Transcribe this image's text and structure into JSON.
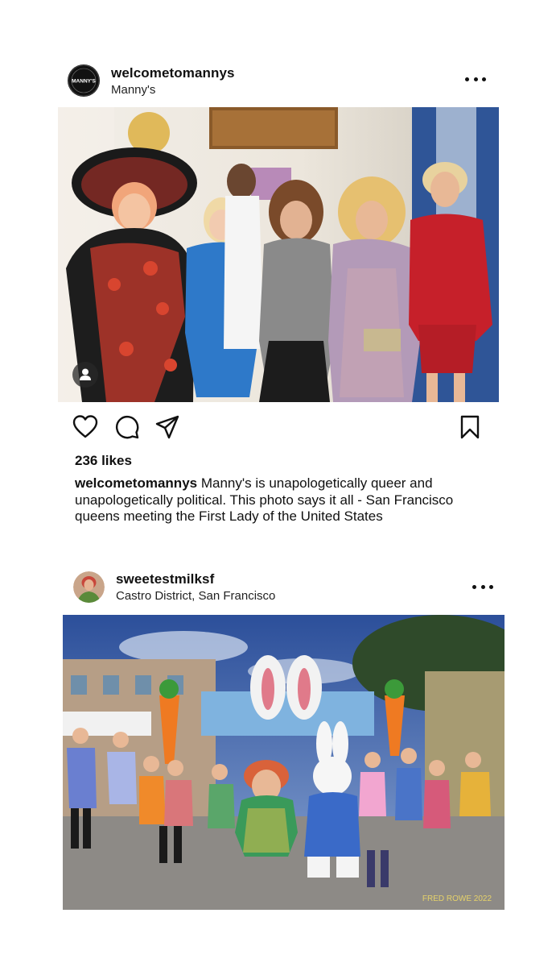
{
  "posts": [
    {
      "username": "welcometomannys",
      "location": "Manny's",
      "avatar_text": "MANNY'S",
      "likes": "236 likes",
      "caption_user": "welcometomannys",
      "caption_text": "Manny's is unapologetically queer and unapologetically political. This photo says it all - San Francisco queens meeting the First Lady of the United States",
      "icons": [
        "more-horizontal-icon",
        "user-tag-icon",
        "heart-icon",
        "comment-icon",
        "share-icon",
        "bookmark-icon"
      ]
    },
    {
      "username": "sweetestmilksf",
      "location": "Castro District, San Francisco",
      "watermark": "FRED ROWE 2022",
      "icons": [
        "more-horizontal-icon"
      ]
    }
  ],
  "colors": {
    "text": "#111111",
    "background": "#ffffff"
  }
}
